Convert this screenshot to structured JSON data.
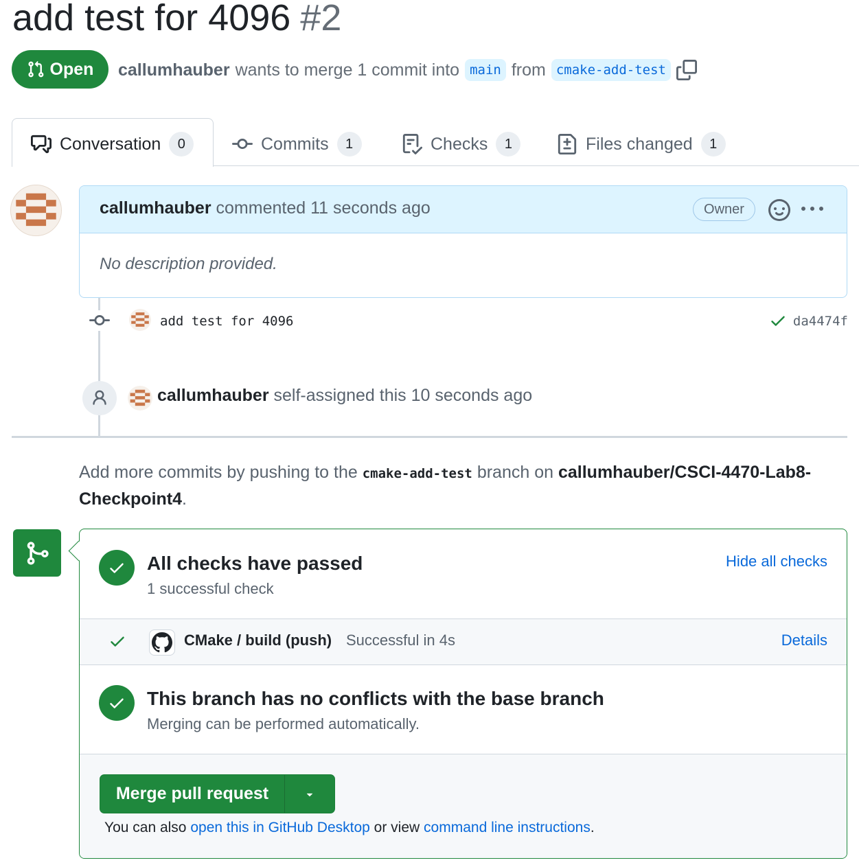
{
  "pr": {
    "title": "add test for 4096",
    "number": "#2",
    "state": "Open",
    "author": "callumhauber",
    "merge_text": "wants to merge 1 commit into",
    "base_branch": "main",
    "from_text": "from",
    "head_branch": "cmake-add-test"
  },
  "tabs": [
    {
      "label": "Conversation",
      "count": "0"
    },
    {
      "label": "Commits",
      "count": "1"
    },
    {
      "label": "Checks",
      "count": "1"
    },
    {
      "label": "Files changed",
      "count": "1"
    }
  ],
  "comment": {
    "author": "callumhauber",
    "action": "commented 11 seconds ago",
    "role": "Owner",
    "body": "No description provided."
  },
  "commit": {
    "message": "add test for 4096",
    "sha": "da4474f"
  },
  "event": {
    "actor": "callumhauber",
    "text": "self-assigned this 10 seconds ago"
  },
  "hint": {
    "prefix": "Add more commits by pushing to the",
    "branch": "cmake-add-test",
    "middle": "branch on",
    "repo": "callumhauber/CSCI-4470-Lab8-Checkpoint4",
    "suffix": "."
  },
  "checks": {
    "title": "All checks have passed",
    "subtitle": "1 successful check",
    "hide_link": "Hide all checks",
    "row_name": "CMake / build (push)",
    "row_status": "Successful in 4s",
    "details_link": "Details"
  },
  "conflicts": {
    "title": "This branch has no conflicts with the base branch",
    "subtitle": "Merging can be performed automatically."
  },
  "merge": {
    "button": "Merge pull request",
    "foot_prefix": "You can also",
    "desktop_link": "open this in GitHub Desktop",
    "foot_middle": "or view",
    "cli_link": "command line instructions",
    "foot_suffix": "."
  },
  "colors": {
    "success": "#1f883d",
    "link": "#0969da",
    "branch_bg": "#ddf4ff"
  }
}
